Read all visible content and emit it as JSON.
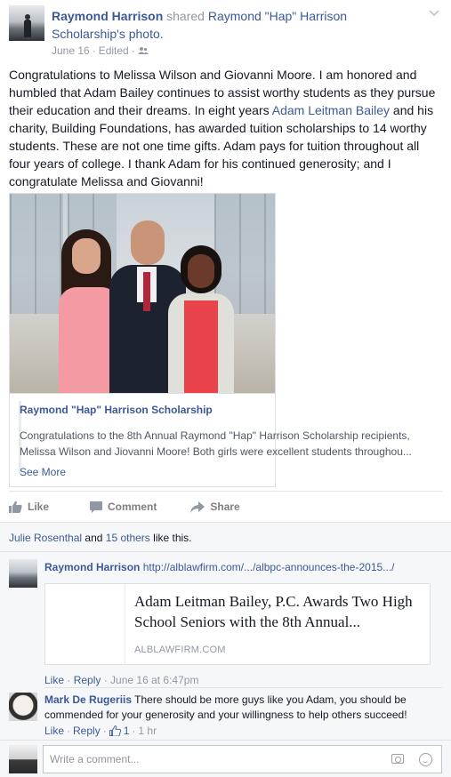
{
  "post": {
    "author": "Raymond Harrison",
    "action_text": "shared",
    "target_name": "Raymond \"Hap\" Harrison Scholarship",
    "target_suffix": "'s photo.",
    "date": "June 16",
    "edited": "Edited",
    "separator": "·",
    "privacy_icon": "friends-icon",
    "body": "Congratulations to Melissa Wilson and Giovanni Moore. I am honored and humbled that Adam Bailey continues to assist worthy students as they pursue their education and their dreams. In eight years ",
    "body_link": "Adam Leitman Bailey",
    "body_rest": " and his charity, Building Foundations, has awarded tuition scholarships to 14 worthy students. These are not one time gifts. Adam pays for tuition throughout all four years of college. I thank Adam for his continued generosity; and I congratulate Melissa and Giovanni!"
  },
  "shared": {
    "title": "Raymond \"Hap\" Harrison Scholarship",
    "description": "Congratulations to the 8th Annual Raymond \"Hap\" Harrison Scholarship recipients, Melissa Wilson and Jiovanni Moore! Both girls were excellent students throughou...",
    "see_more": "See More"
  },
  "actions": {
    "like": "Like",
    "comment": "Comment",
    "share": "Share"
  },
  "likes": {
    "first": "Julie Rosenthal",
    "and": " and ",
    "others": "15 others",
    "suffix": " like this."
  },
  "comments": [
    {
      "author": "Raymond Harrison",
      "text": "http://alblawfirm.com/.../albpc-announces-the-2015.../",
      "link_title": "Adam Leitman Bailey, P.C. Awards Two High School Seniors with the 8th Annual...",
      "link_domain": "ALBLAWFIRM.COM",
      "like": "Like",
      "reply": "Reply",
      "time": "June 16 at 6:47pm"
    },
    {
      "author": "Mark De Rugeriis",
      "text": "There should be more guys like you Adam, you should be commended for your generosity and your willingness to help others succeed!",
      "like": "Like",
      "reply": "Reply",
      "like_count": "1",
      "time": "1 hr"
    }
  ],
  "write_comment": {
    "placeholder": "Write a comment..."
  },
  "colors": {
    "link": "#3b5998",
    "meta": "#9197a3",
    "text": "#141823"
  }
}
